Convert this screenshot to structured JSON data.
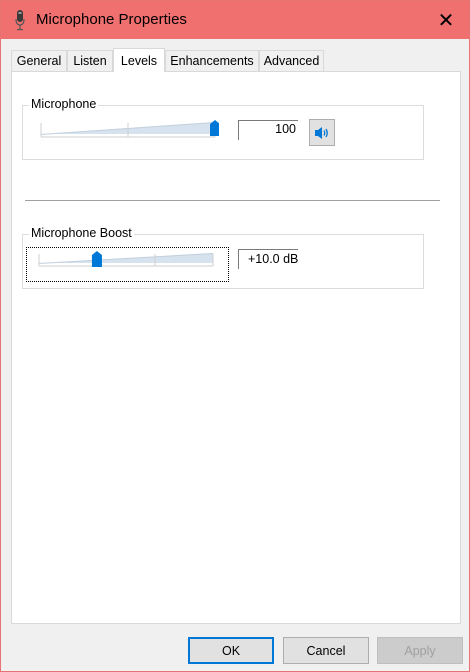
{
  "window": {
    "title": "Microphone Properties",
    "close_symbol": "✕"
  },
  "tabs": [
    {
      "label": "General",
      "active": false
    },
    {
      "label": "Listen",
      "active": false
    },
    {
      "label": "Levels",
      "active": true
    },
    {
      "label": "Enhancements",
      "active": false
    },
    {
      "label": "Advanced",
      "active": false
    }
  ],
  "microphone": {
    "label": "Microphone",
    "level_value": "100",
    "level_fraction": 1.0,
    "mute_icon": "speaker-icon"
  },
  "boost": {
    "label": "Microphone Boost",
    "value": "+10.0 dB",
    "level_fraction": 0.333
  },
  "buttons": {
    "ok": "OK",
    "cancel": "Cancel",
    "apply": "Apply"
  },
  "colors": {
    "titlebar": "#f07070",
    "accent": "#0078d7",
    "thumb": "#0078d7"
  }
}
